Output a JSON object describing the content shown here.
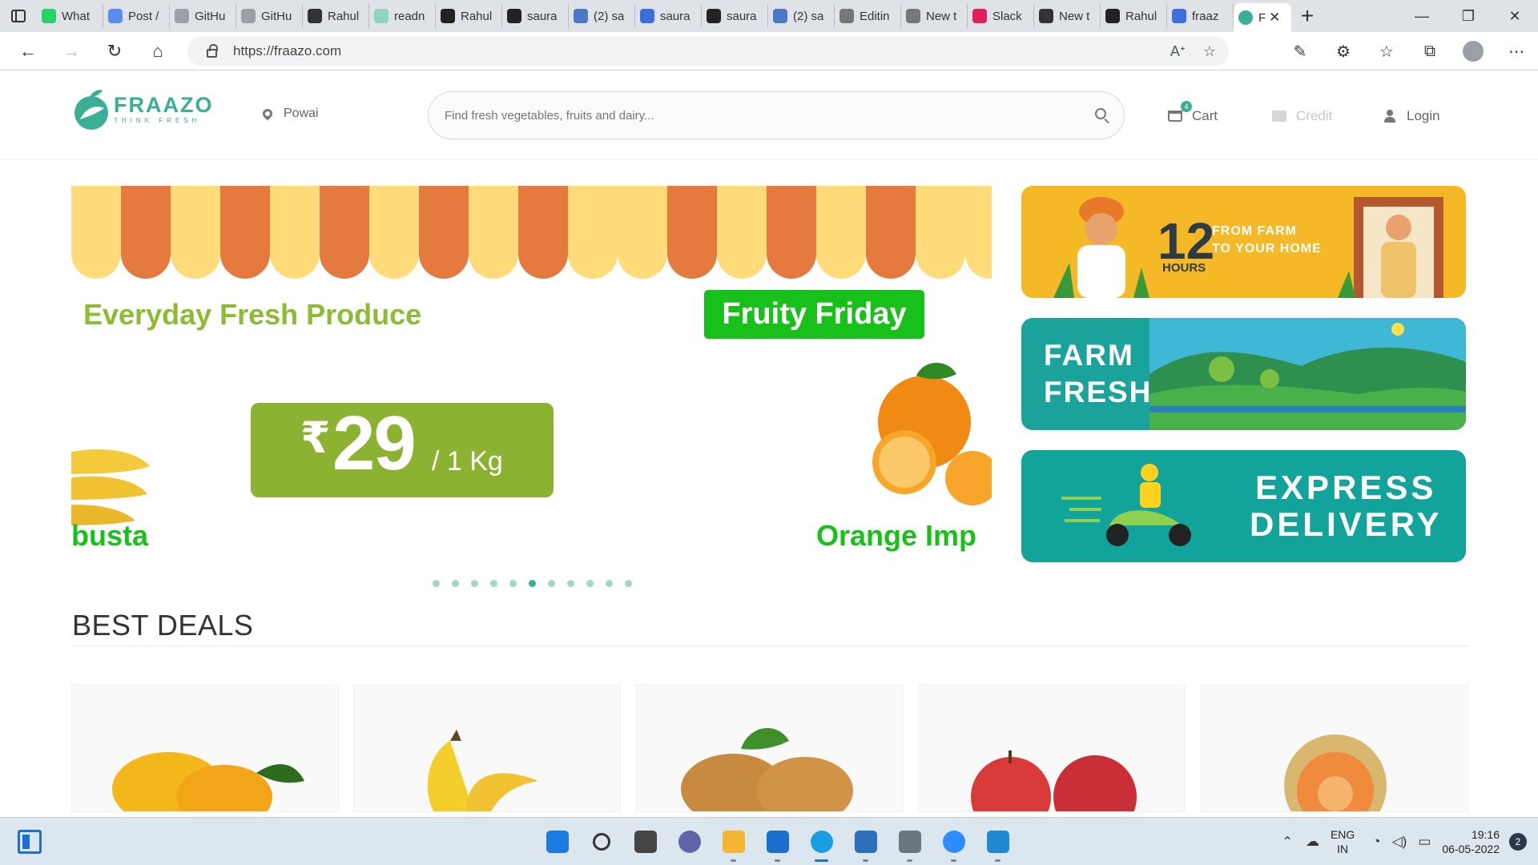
{
  "browser": {
    "tabs": [
      {
        "label": "What",
        "icon": "whatsapp-icon",
        "color": "#25d366"
      },
      {
        "label": "Post /",
        "icon": "zoom-icon",
        "color": "#5b8def"
      },
      {
        "label": "GitHu",
        "icon": "page-icon",
        "color": "#9aa0a6"
      },
      {
        "label": "GitHu",
        "icon": "page-icon",
        "color": "#9aa0a6"
      },
      {
        "label": "Rahul",
        "icon": "github-icon",
        "color": "#333333"
      },
      {
        "label": "readn",
        "icon": "page-icon",
        "color": "#8fd3c1"
      },
      {
        "label": "Rahul",
        "icon": "r-icon",
        "color": "#222222"
      },
      {
        "label": "saura",
        "icon": "github-icon",
        "color": "#222222"
      },
      {
        "label": "(2) sa",
        "icon": "linkedin-icon",
        "color": "#4a78c4"
      },
      {
        "label": "saura",
        "icon": "docs-icon",
        "color": "#3b6fe0"
      },
      {
        "label": "saura",
        "icon": "github-icon",
        "color": "#222222"
      },
      {
        "label": "(2) sa",
        "icon": "linkedin-icon",
        "color": "#4a78c4"
      },
      {
        "label": "Editin",
        "icon": "github-icon",
        "color": "#777777"
      },
      {
        "label": "New t",
        "icon": "newtab-icon",
        "color": "#777777"
      },
      {
        "label": "Slack",
        "icon": "slack-icon",
        "color": "#e01e5a"
      },
      {
        "label": "New t",
        "icon": "newtab-icon",
        "color": "#333333"
      },
      {
        "label": "Rahul",
        "icon": "r-icon",
        "color": "#222222"
      },
      {
        "label": "fraaz",
        "icon": "search-icon",
        "color": "#3b6fe0"
      }
    ],
    "active_tab": {
      "label": "F",
      "icon": "fraazo-favicon"
    },
    "url": "https://fraazo.com"
  },
  "site": {
    "logo_name": "FRAAZO",
    "logo_tagline": "THINK FRESH",
    "location": "Powai",
    "search_placeholder": "Find fresh vegetables, fruits and dairy...",
    "cart_label": "Cart",
    "cart_count": "4",
    "credit_label": "Credit",
    "login_label": "Login",
    "accent_color": "#3bae96"
  },
  "carousel": {
    "title": "Everyday Fresh Produce",
    "badge": "Fruity Friday",
    "price_currency": "₹",
    "price_amount": "29",
    "price_unit": "/ 1 Kg",
    "left_product": "busta",
    "right_product": "Orange Imp",
    "dot_count": 11,
    "active_dot": 5
  },
  "banners": {
    "farm_hours": "12",
    "farm_hours_label": "HOURS",
    "farm_line1": "FROM FARM",
    "farm_line2": "TO YOUR HOME",
    "farm_fresh_line1": "FARM",
    "farm_fresh_line2": "FRESH",
    "express_line1": "EXPRESS",
    "express_line2": "DELIVERY"
  },
  "best_deals": {
    "heading": "BEST DEALS",
    "products": [
      "mango",
      "banana",
      "potato",
      "apple",
      "muskmelon"
    ]
  },
  "taskbar": {
    "apps": [
      "windows-start",
      "search",
      "task-view",
      "teams-chat",
      "file-explorer",
      "mail",
      "edge",
      "photos",
      "settings",
      "zoom",
      "vscode"
    ],
    "lang_line1": "ENG",
    "lang_line2": "IN",
    "time": "19:16",
    "date": "06-05-2022",
    "notifications": "2"
  }
}
